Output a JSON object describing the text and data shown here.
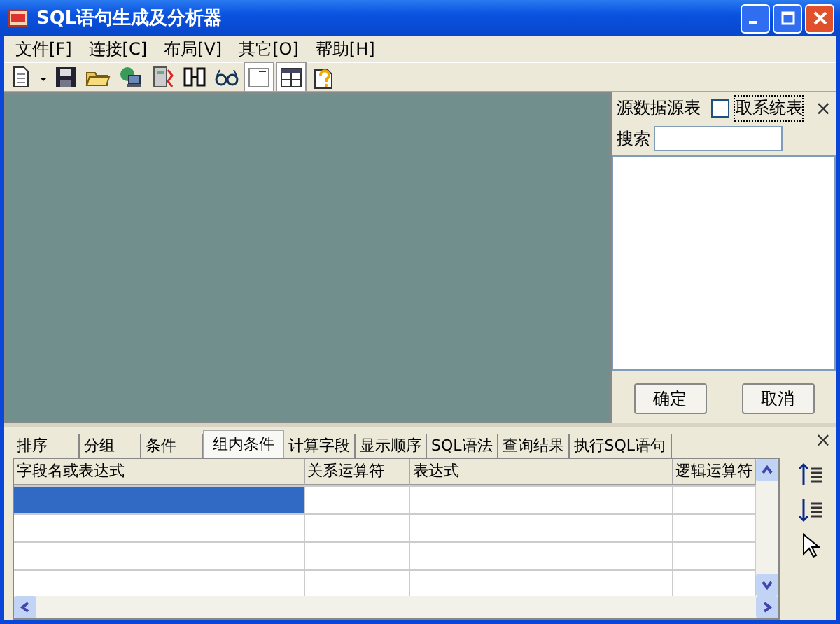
{
  "window": {
    "title": "SQL语句生成及分析器"
  },
  "menu": [
    "文件[F]",
    "连接[C]",
    "布局[V]",
    "其它[O]",
    "帮助[H]"
  ],
  "toolbar": [
    {
      "kind": "new",
      "pressed": false
    },
    {
      "kind": "caret",
      "pressed": false
    },
    {
      "kind": "save",
      "pressed": false
    },
    {
      "kind": "open",
      "pressed": false
    },
    {
      "kind": "network",
      "pressed": false
    },
    {
      "kind": "database",
      "pressed": false
    },
    {
      "kind": "split",
      "pressed": false
    },
    {
      "kind": "glasses",
      "pressed": false
    },
    {
      "kind": "blank",
      "pressed": true
    },
    {
      "kind": "layout",
      "pressed": true
    },
    {
      "kind": "help",
      "pressed": false
    }
  ],
  "source_panel": {
    "title": "源数据源表",
    "system_tables": {
      "label": "取系统表",
      "checked": false
    },
    "close": "×",
    "search_label": "搜索",
    "ok": "确定",
    "cancel": "取消"
  },
  "bottom_panel": {
    "close": "×",
    "tabs": [
      {
        "label": "排序",
        "selected": false
      },
      {
        "label": "分组",
        "selected": false
      },
      {
        "label": "条件",
        "selected": false
      },
      {
        "label": "组内条件",
        "selected": true
      },
      {
        "label": "计算字段",
        "selected": false
      },
      {
        "label": "显示顺序",
        "selected": false
      },
      {
        "label": "SQL语法",
        "selected": false
      },
      {
        "label": "查询结果",
        "selected": false
      },
      {
        "label": "执行SQL语句",
        "selected": false
      }
    ],
    "table": {
      "columns": [
        "字段名或表达式",
        "关系运算符",
        "表达式",
        "逻辑运算符"
      ],
      "rows": [
        {
          "selected": true
        },
        {
          "selected": false
        },
        {
          "selected": false
        },
        {
          "selected": false
        }
      ]
    }
  }
}
